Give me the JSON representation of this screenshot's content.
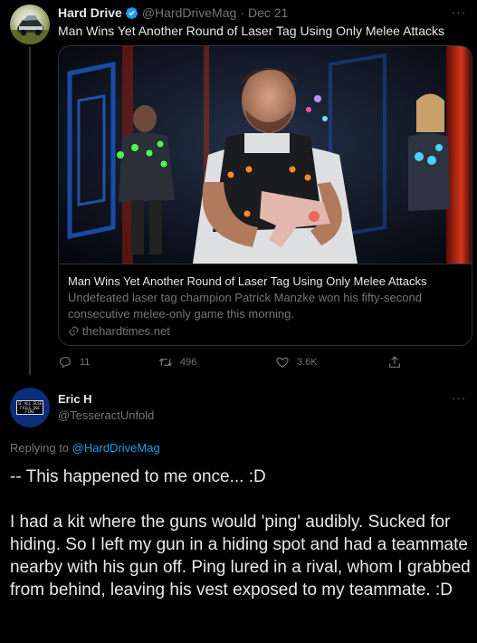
{
  "tweet1": {
    "author_name": "Hard Drive",
    "author_handle": "@HardDriveMag",
    "date_sep": "·",
    "date": "Dec 21",
    "more_label": "···",
    "text": "Man Wins Yet Another Round of Laser Tag Using Only Melee Attacks",
    "card": {
      "title": "Man Wins Yet Another Round of Laser Tag Using Only Melee Attacks",
      "description": "Undefeated laser tag champion Patrick Manzke won his fifty-second consecutive melee-only game this morning.",
      "domain": "thehardtimes.net"
    },
    "actions": {
      "replies": "11",
      "retweets": "496",
      "likes": "3.6K"
    }
  },
  "tweet2": {
    "author_name": "Eric H",
    "author_handle": "@TesseractUnfold",
    "more_label": "···",
    "avatar_text": "IF ALL ELSE FAILS USE FIRE",
    "replying_prefix": "Replying to",
    "replying_to": "@HardDriveMag",
    "paragraphs": [
      "-- This happened to me once... :D",
      "I had a kit where the guns would 'ping' audibly.  Sucked for hiding.  So I left my gun in a hiding spot and had a teammate nearby with his gun off.  Ping lured in a rival, whom I grabbed from behind, leaving his vest exposed to my teammate. :D"
    ]
  },
  "colors": {
    "background": "#000000",
    "text_primary": "#e7e9ea",
    "text_secondary": "#71767b",
    "link": "#1d9bf0",
    "verified": "#1d9bf0",
    "border": "#2f3336"
  },
  "icons": [
    "verified-badge-icon",
    "link-icon",
    "reply-icon",
    "retweet-icon",
    "like-icon",
    "share-icon",
    "more-icon"
  ]
}
